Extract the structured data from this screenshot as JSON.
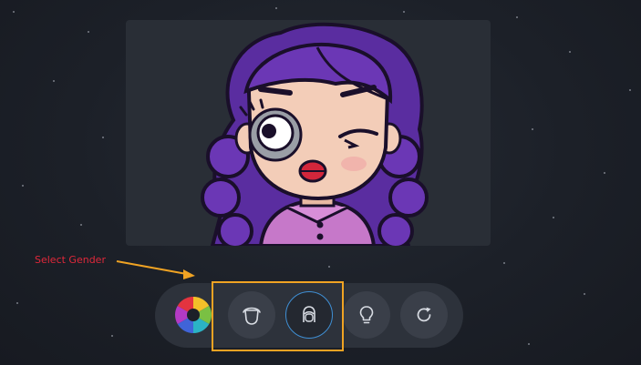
{
  "annotation": {
    "label": "Select Gender",
    "label_color": "#e0283a",
    "highlight_color": "#f0a323"
  },
  "avatar": {
    "hair_color": "#6b37b5",
    "shirt_color": "#c678c9",
    "skin_color": "#f3cdb8"
  },
  "toolbar": {
    "buttons": [
      {
        "icon": "color-wheel-icon",
        "active": false
      },
      {
        "icon": "male-face-icon",
        "active": false
      },
      {
        "icon": "female-face-icon",
        "active": true
      },
      {
        "icon": "lightbulb-icon",
        "active": false
      },
      {
        "icon": "refresh-icon",
        "active": false
      }
    ],
    "accent_color": "#3f8fd4"
  }
}
